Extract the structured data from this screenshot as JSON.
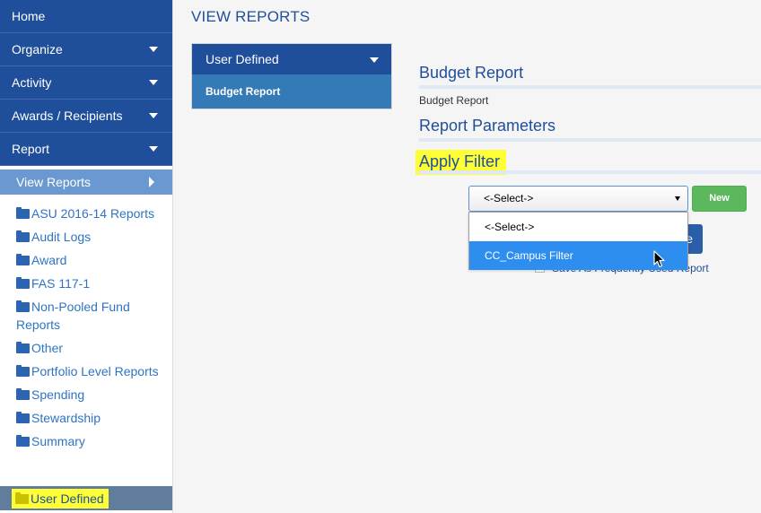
{
  "sidebar": {
    "nav": [
      {
        "label": "Home",
        "has_caret": false
      },
      {
        "label": "Organize",
        "has_caret": true
      },
      {
        "label": "Activity",
        "has_caret": true
      },
      {
        "label": "Awards / Recipients",
        "has_caret": true
      },
      {
        "label": "Report",
        "has_caret": true
      }
    ],
    "view_reports_label": "View Reports",
    "folders": [
      "ASU 2016-14 Reports",
      "Audit Logs",
      "Award",
      "FAS 117-1",
      "Non-Pooled Fund Reports",
      "Other",
      "Portfolio Level Reports",
      "Spending",
      "Stewardship",
      "Summary"
    ],
    "selected_folder": "User Defined"
  },
  "main": {
    "page_title": "VIEW REPORTS",
    "report_box": {
      "category_label": "User Defined",
      "report_item": "Budget Report"
    },
    "budget_report_heading": "Budget Report",
    "budget_report_name": "Budget Report",
    "report_parameters_heading": "Report Parameters",
    "apply_filter_heading": "Apply Filter",
    "filter_select": {
      "selected_value": "<-Select->",
      "options": [
        "<-Select->",
        "CC_Campus Filter"
      ],
      "highlighted_option": "CC_Campus Filter"
    },
    "new_button_label": "New",
    "partially_hidden_button_label": "e",
    "save_checkbox_label": "Save As Frequently Used Report"
  },
  "colors": {
    "nav_bg": "#1f4f9b",
    "view_reports_bg": "#6a99d1",
    "link_blue": "#2e74c3",
    "highlight_yellow": "#ffff37",
    "selected_row_bg": "#607e9b",
    "new_button_green": "#5cb85c",
    "dropdown_active": "#2e8ef0"
  },
  "icons": {
    "folder": "folder-icon",
    "caret_down": "caret-down-icon",
    "caret_right": "caret-right-icon",
    "cursor": "mouse-pointer-icon"
  }
}
